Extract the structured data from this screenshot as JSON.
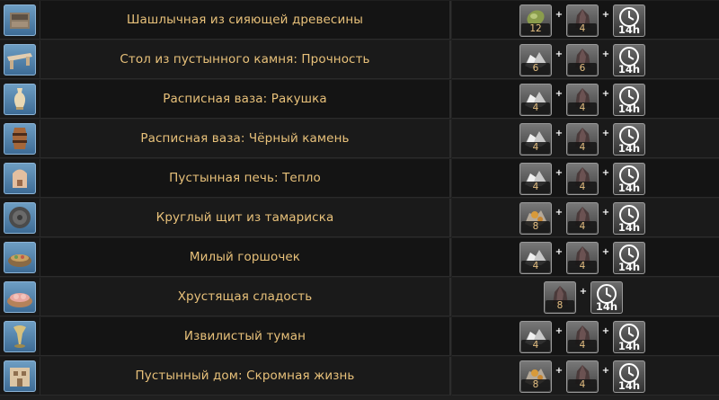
{
  "rows": [
    {
      "name": "Шашлычная из сияющей древесины",
      "icon": "grill-icon",
      "mats": [
        {
          "icon": "glowing-wood-icon",
          "count": "12"
        },
        {
          "icon": "dark-stone-icon",
          "count": "4"
        },
        {
          "icon": "clock-icon",
          "count": "14h"
        }
      ]
    },
    {
      "name": "Стол из пустынного камня: Прочность",
      "icon": "stone-table-icon",
      "mats": [
        {
          "icon": "silver-ore-icon",
          "count": "6"
        },
        {
          "icon": "dark-stone-icon",
          "count": "6"
        },
        {
          "icon": "clock-icon",
          "count": "14h"
        }
      ]
    },
    {
      "name": "Расписная ваза: Ракушка",
      "icon": "shell-vase-icon",
      "mats": [
        {
          "icon": "silver-ore-icon",
          "count": "4"
        },
        {
          "icon": "dark-stone-icon",
          "count": "4"
        },
        {
          "icon": "clock-icon",
          "count": "14h"
        }
      ]
    },
    {
      "name": "Расписная ваза: Чёрный камень",
      "icon": "black-stone-vase-icon",
      "mats": [
        {
          "icon": "silver-ore-icon",
          "count": "4"
        },
        {
          "icon": "dark-stone-icon",
          "count": "4"
        },
        {
          "icon": "clock-icon",
          "count": "14h"
        }
      ]
    },
    {
      "name": "Пустынная печь: Тепло",
      "icon": "desert-oven-icon",
      "mats": [
        {
          "icon": "silver-ore-icon",
          "count": "4"
        },
        {
          "icon": "dark-stone-icon",
          "count": "4"
        },
        {
          "icon": "clock-icon",
          "count": "14h"
        }
      ]
    },
    {
      "name": "Круглый щит из тамариска",
      "icon": "round-shield-icon",
      "mats": [
        {
          "icon": "copper-ore-icon",
          "count": "8"
        },
        {
          "icon": "dark-stone-icon",
          "count": "4"
        },
        {
          "icon": "clock-icon",
          "count": "14h"
        }
      ]
    },
    {
      "name": "Милый горшочек",
      "icon": "cute-pot-icon",
      "mats": [
        {
          "icon": "silver-ore-icon",
          "count": "4"
        },
        {
          "icon": "dark-stone-icon",
          "count": "4"
        },
        {
          "icon": "clock-icon",
          "count": "14h"
        }
      ]
    },
    {
      "name": "Хрустящая сладость",
      "icon": "crunchy-sweet-icon",
      "mats": [
        {
          "icon": "dark-stone-icon",
          "count": "8"
        },
        {
          "icon": "clock-icon",
          "count": "14h"
        }
      ]
    },
    {
      "name": "Извилистый туман",
      "icon": "winding-mist-icon",
      "mats": [
        {
          "icon": "silver-ore-icon",
          "count": "4"
        },
        {
          "icon": "dark-stone-icon",
          "count": "4"
        },
        {
          "icon": "clock-icon",
          "count": "14h"
        }
      ]
    },
    {
      "name": "Пустынный дом: Скромная жизнь",
      "icon": "desert-house-icon",
      "mats": [
        {
          "icon": "copper-ore-icon",
          "count": "8"
        },
        {
          "icon": "dark-stone-icon",
          "count": "4"
        },
        {
          "icon": "clock-icon",
          "count": "14h"
        }
      ]
    }
  ],
  "plus_symbol": "+",
  "colors": {
    "name_text": "#e8c17a",
    "count_text": "#e6c082",
    "time_text": "#ffffff",
    "item_icon_bg": "#4f82ad",
    "mat_slot_bg": "#5a5a5a"
  }
}
